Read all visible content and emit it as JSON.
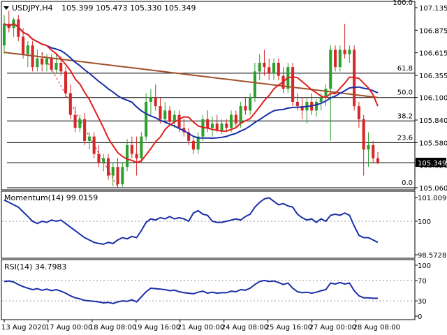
{
  "header": {
    "menu_icon": "triangle-down-icon",
    "symbol": "USDJPY,H4",
    "ohlc": "105.399 105.473 105.330 105.349"
  },
  "price_panel": {
    "price_labels": [
      "107.135",
      "106.875",
      "106.615",
      "106.355",
      "106.100",
      "105.840",
      "105.580",
      "105.320",
      "105.060"
    ],
    "current_price": "105.349",
    "fib_labels": [
      "100.0",
      "61.8",
      "50.0",
      "38.2",
      "23.6",
      "0.0"
    ],
    "fib_levels": [
      107.135,
      106.38,
      106.1,
      105.83,
      105.58,
      105.06
    ],
    "colors": {
      "bull": "#2ca02c",
      "bear": "#d62728",
      "sma_fast": "#e02020",
      "sma_mid": "#1a2ea8",
      "sma_slow": "#a0522d",
      "trend": "#d62728"
    }
  },
  "candles": [
    {
      "o": 106.7,
      "h": 107.05,
      "l": 106.6,
      "c": 106.95
    },
    {
      "o": 106.95,
      "h": 107.1,
      "l": 106.85,
      "c": 106.9
    },
    {
      "o": 106.9,
      "h": 107.02,
      "l": 106.8,
      "c": 107.0
    },
    {
      "o": 107.0,
      "h": 107.05,
      "l": 106.75,
      "c": 106.8
    },
    {
      "o": 106.8,
      "h": 106.9,
      "l": 106.55,
      "c": 106.6
    },
    {
      "o": 106.6,
      "h": 106.75,
      "l": 106.45,
      "c": 106.7
    },
    {
      "o": 106.7,
      "h": 106.75,
      "l": 106.4,
      "c": 106.45
    },
    {
      "o": 106.45,
      "h": 106.65,
      "l": 106.4,
      "c": 106.55
    },
    {
      "o": 106.55,
      "h": 106.62,
      "l": 106.4,
      "c": 106.48
    },
    {
      "o": 106.48,
      "h": 106.6,
      "l": 106.4,
      "c": 106.55
    },
    {
      "o": 106.55,
      "h": 106.6,
      "l": 106.4,
      "c": 106.42
    },
    {
      "o": 106.42,
      "h": 106.6,
      "l": 106.38,
      "c": 106.5
    },
    {
      "o": 106.5,
      "h": 106.58,
      "l": 106.35,
      "c": 106.4
    },
    {
      "o": 106.4,
      "h": 106.45,
      "l": 106.1,
      "c": 106.15
    },
    {
      "o": 106.15,
      "h": 106.25,
      "l": 105.85,
      "c": 105.9
    },
    {
      "o": 105.9,
      "h": 106.0,
      "l": 105.7,
      "c": 105.75
    },
    {
      "o": 105.75,
      "h": 105.9,
      "l": 105.7,
      "c": 105.85
    },
    {
      "o": 105.85,
      "h": 105.92,
      "l": 105.55,
      "c": 105.6
    },
    {
      "o": 105.6,
      "h": 105.7,
      "l": 105.5,
      "c": 105.65
    },
    {
      "o": 105.65,
      "h": 105.7,
      "l": 105.4,
      "c": 105.45
    },
    {
      "o": 105.45,
      "h": 105.55,
      "l": 105.3,
      "c": 105.35
    },
    {
      "o": 105.35,
      "h": 105.45,
      "l": 105.25,
      "c": 105.4
    },
    {
      "o": 105.4,
      "h": 105.45,
      "l": 105.15,
      "c": 105.2
    },
    {
      "o": 105.2,
      "h": 105.35,
      "l": 105.08,
      "c": 105.3
    },
    {
      "o": 105.3,
      "h": 105.4,
      "l": 105.06,
      "c": 105.1
    },
    {
      "o": 105.1,
      "h": 105.35,
      "l": 105.07,
      "c": 105.3
    },
    {
      "o": 105.3,
      "h": 105.62,
      "l": 105.25,
      "c": 105.55
    },
    {
      "o": 105.55,
      "h": 105.65,
      "l": 105.4,
      "c": 105.45
    },
    {
      "o": 105.45,
      "h": 105.65,
      "l": 105.2,
      "c": 105.4
    },
    {
      "o": 105.4,
      "h": 105.7,
      "l": 105.35,
      "c": 105.65
    },
    {
      "o": 105.65,
      "h": 106.15,
      "l": 105.6,
      "c": 106.05
    },
    {
      "o": 106.05,
      "h": 106.2,
      "l": 105.9,
      "c": 106.1
    },
    {
      "o": 106.1,
      "h": 106.25,
      "l": 105.95,
      "c": 106.0
    },
    {
      "o": 106.0,
      "h": 106.1,
      "l": 105.8,
      "c": 105.85
    },
    {
      "o": 105.85,
      "h": 106.05,
      "l": 105.8,
      "c": 105.95
    },
    {
      "o": 105.95,
      "h": 106.0,
      "l": 105.8,
      "c": 105.82
    },
    {
      "o": 105.82,
      "h": 105.95,
      "l": 105.75,
      "c": 105.9
    },
    {
      "o": 105.9,
      "h": 105.95,
      "l": 105.7,
      "c": 105.75
    },
    {
      "o": 105.75,
      "h": 105.85,
      "l": 105.65,
      "c": 105.7
    },
    {
      "o": 105.7,
      "h": 105.75,
      "l": 105.55,
      "c": 105.6
    },
    {
      "o": 105.6,
      "h": 105.65,
      "l": 105.45,
      "c": 105.5
    },
    {
      "o": 105.5,
      "h": 105.7,
      "l": 105.45,
      "c": 105.65
    },
    {
      "o": 105.65,
      "h": 105.9,
      "l": 105.6,
      "c": 105.85
    },
    {
      "o": 105.85,
      "h": 105.95,
      "l": 105.7,
      "c": 105.75
    },
    {
      "o": 105.75,
      "h": 105.88,
      "l": 105.65,
      "c": 105.8
    },
    {
      "o": 105.8,
      "h": 105.9,
      "l": 105.7,
      "c": 105.72
    },
    {
      "o": 105.72,
      "h": 105.85,
      "l": 105.68,
      "c": 105.8
    },
    {
      "o": 105.8,
      "h": 105.85,
      "l": 105.7,
      "c": 105.75
    },
    {
      "o": 105.75,
      "h": 105.95,
      "l": 105.7,
      "c": 105.9
    },
    {
      "o": 105.9,
      "h": 105.95,
      "l": 105.75,
      "c": 105.8
    },
    {
      "o": 105.8,
      "h": 106.05,
      "l": 105.75,
      "c": 106.0
    },
    {
      "o": 106.0,
      "h": 106.1,
      "l": 105.9,
      "c": 105.95
    },
    {
      "o": 105.95,
      "h": 106.15,
      "l": 105.9,
      "c": 106.1
    },
    {
      "o": 106.1,
      "h": 106.5,
      "l": 106.05,
      "c": 106.4
    },
    {
      "o": 106.4,
      "h": 106.6,
      "l": 106.3,
      "c": 106.5
    },
    {
      "o": 106.5,
      "h": 106.65,
      "l": 106.35,
      "c": 106.45
    },
    {
      "o": 106.45,
      "h": 106.55,
      "l": 106.3,
      "c": 106.38
    },
    {
      "o": 106.38,
      "h": 106.55,
      "l": 106.3,
      "c": 106.5
    },
    {
      "o": 106.5,
      "h": 106.55,
      "l": 106.3,
      "c": 106.35
    },
    {
      "o": 106.35,
      "h": 106.45,
      "l": 106.15,
      "c": 106.2
    },
    {
      "o": 106.2,
      "h": 106.5,
      "l": 106.15,
      "c": 106.45
    },
    {
      "o": 106.45,
      "h": 106.5,
      "l": 106.0,
      "c": 106.05
    },
    {
      "o": 106.05,
      "h": 106.15,
      "l": 105.95,
      "c": 106.0
    },
    {
      "o": 106.0,
      "h": 106.1,
      "l": 105.85,
      "c": 105.95
    },
    {
      "o": 105.95,
      "h": 106.1,
      "l": 105.8,
      "c": 106.05
    },
    {
      "o": 106.05,
      "h": 106.15,
      "l": 105.9,
      "c": 105.95
    },
    {
      "o": 105.95,
      "h": 106.08,
      "l": 105.88,
      "c": 106.05
    },
    {
      "o": 106.05,
      "h": 106.15,
      "l": 105.95,
      "c": 106.1
    },
    {
      "o": 106.1,
      "h": 106.25,
      "l": 106.0,
      "c": 106.2
    },
    {
      "o": 106.2,
      "h": 106.7,
      "l": 105.6,
      "c": 106.65
    },
    {
      "o": 106.65,
      "h": 106.7,
      "l": 106.4,
      "c": 106.45
    },
    {
      "o": 106.45,
      "h": 106.7,
      "l": 106.4,
      "c": 106.65
    },
    {
      "o": 106.65,
      "h": 106.95,
      "l": 106.55,
      "c": 106.6
    },
    {
      "o": 106.6,
      "h": 106.7,
      "l": 106.5,
      "c": 106.65
    },
    {
      "o": 106.65,
      "h": 106.7,
      "l": 105.95,
      "c": 106.0
    },
    {
      "o": 106.0,
      "h": 106.05,
      "l": 105.75,
      "c": 105.85
    },
    {
      "o": 105.85,
      "h": 105.9,
      "l": 105.2,
      "c": 105.5
    },
    {
      "o": 105.5,
      "h": 105.7,
      "l": 105.3,
      "c": 105.55
    },
    {
      "o": 105.55,
      "h": 105.6,
      "l": 105.35,
      "c": 105.4
    },
    {
      "o": 105.4,
      "h": 105.47,
      "l": 105.33,
      "c": 105.35
    }
  ],
  "momentum_panel": {
    "title": "Momentum(14) 99.0159",
    "labels": [
      "101.0091",
      "100",
      "98.5728"
    ],
    "values": [
      100.9,
      100.8,
      100.7,
      100.6,
      100.4,
      100.2,
      100.0,
      99.9,
      100.0,
      99.95,
      100.05,
      100.0,
      100.05,
      99.9,
      99.75,
      99.6,
      99.45,
      99.3,
      99.2,
      99.1,
      99.05,
      99.02,
      99.1,
      99.05,
      99.2,
      99.3,
      99.25,
      99.35,
      99.3,
      99.6,
      99.95,
      100.1,
      100.05,
      100.15,
      100.1,
      100.2,
      100.1,
      100.15,
      100.1,
      100.0,
      100.35,
      100.45,
      100.3,
      100.25,
      100.0,
      99.95,
      99.95,
      100.0,
      100.05,
      100.1,
      100.05,
      100.2,
      100.3,
      100.6,
      100.8,
      100.95,
      101.0,
      100.85,
      100.7,
      100.75,
      100.65,
      100.6,
      100.3,
      100.15,
      100.05,
      100.1,
      99.95,
      100.1,
      100.0,
      100.25,
      100.3,
      100.25,
      100.35,
      100.25,
      99.8,
      99.4,
      99.3,
      99.3,
      99.2,
      99.1
    ],
    "ylim": [
      98.5728,
      101.0091
    ]
  },
  "rsi_panel": {
    "title": "RSI(14) 34.7983",
    "labels": [
      "100",
      "70",
      "30",
      "0"
    ],
    "values": [
      68,
      69,
      67,
      62,
      58,
      55,
      52,
      54,
      51,
      53,
      50,
      52,
      49,
      45,
      40,
      36,
      34,
      31,
      30,
      29,
      28,
      26,
      27,
      25,
      28,
      30,
      29,
      32,
      28,
      38,
      48,
      55,
      54,
      53,
      52,
      50,
      51,
      48,
      46,
      45,
      44,
      47,
      49,
      45,
      47,
      45,
      46,
      46,
      49,
      48,
      52,
      51,
      55,
      62,
      68,
      70,
      68,
      69,
      66,
      62,
      65,
      55,
      48,
      46,
      47,
      45,
      47,
      50,
      52,
      65,
      63,
      66,
      63,
      65,
      50,
      40,
      36,
      36,
      35,
      35
    ],
    "ylim": [
      0,
      100
    ]
  },
  "time_axis": {
    "labels": [
      "13 Aug 2020",
      "17 Aug 00:00",
      "18 Aug 08:00",
      "19 Aug 16:00",
      "21 Aug 00:00",
      "24 Aug 08:00",
      "25 Aug 16:00",
      "27 Aug 00:00",
      "28 Aug 08:00"
    ],
    "label_bars": [
      0,
      16,
      32,
      48,
      64,
      80,
      96,
      112,
      128
    ]
  }
}
